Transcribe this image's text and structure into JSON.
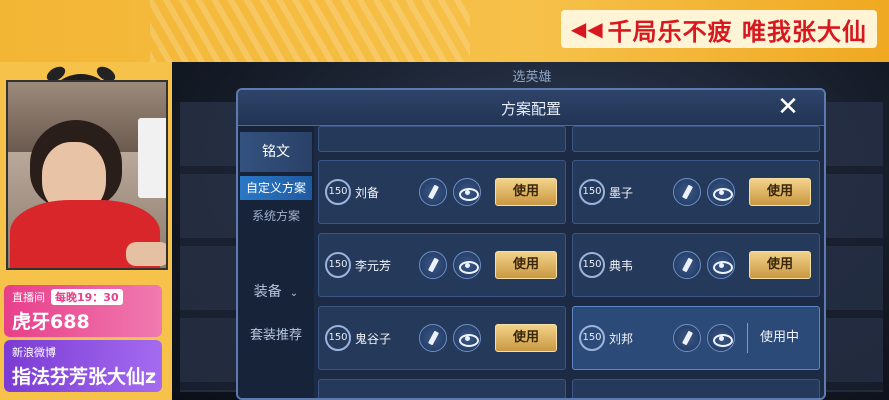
{
  "banner": {
    "slogan": "千局乐不疲 唯我张大仙",
    "arrows": "◀◀"
  },
  "stream": {
    "huya_label": "直播间",
    "schedule": "每晚19：30",
    "huya_id": "虎牙688",
    "weibo_label": "新浪微博",
    "weibo_id": "指法芬芳张大仙z"
  },
  "game": {
    "background_tab": "选英雄"
  },
  "dialog": {
    "title": "方案配置",
    "close_symbol": "✕",
    "sidebar": {
      "main_label": "铭文",
      "sub_custom": "自定义方案",
      "sub_system": "系统方案",
      "equipment": "装备",
      "recommended": "套装推荐",
      "chevron": "⌄"
    },
    "use_label": "使用",
    "in_use_label": "使用中",
    "rows": [
      {
        "level": "150",
        "hero": "刘备",
        "state": "use"
      },
      {
        "level": "150",
        "hero": "墨子",
        "state": "use"
      },
      {
        "level": "150",
        "hero": "李元芳",
        "state": "use"
      },
      {
        "level": "150",
        "hero": "典韦",
        "state": "use"
      },
      {
        "level": "150",
        "hero": "鬼谷子",
        "state": "use"
      },
      {
        "level": "150",
        "hero": "刘邦",
        "state": "in_use"
      }
    ]
  }
}
